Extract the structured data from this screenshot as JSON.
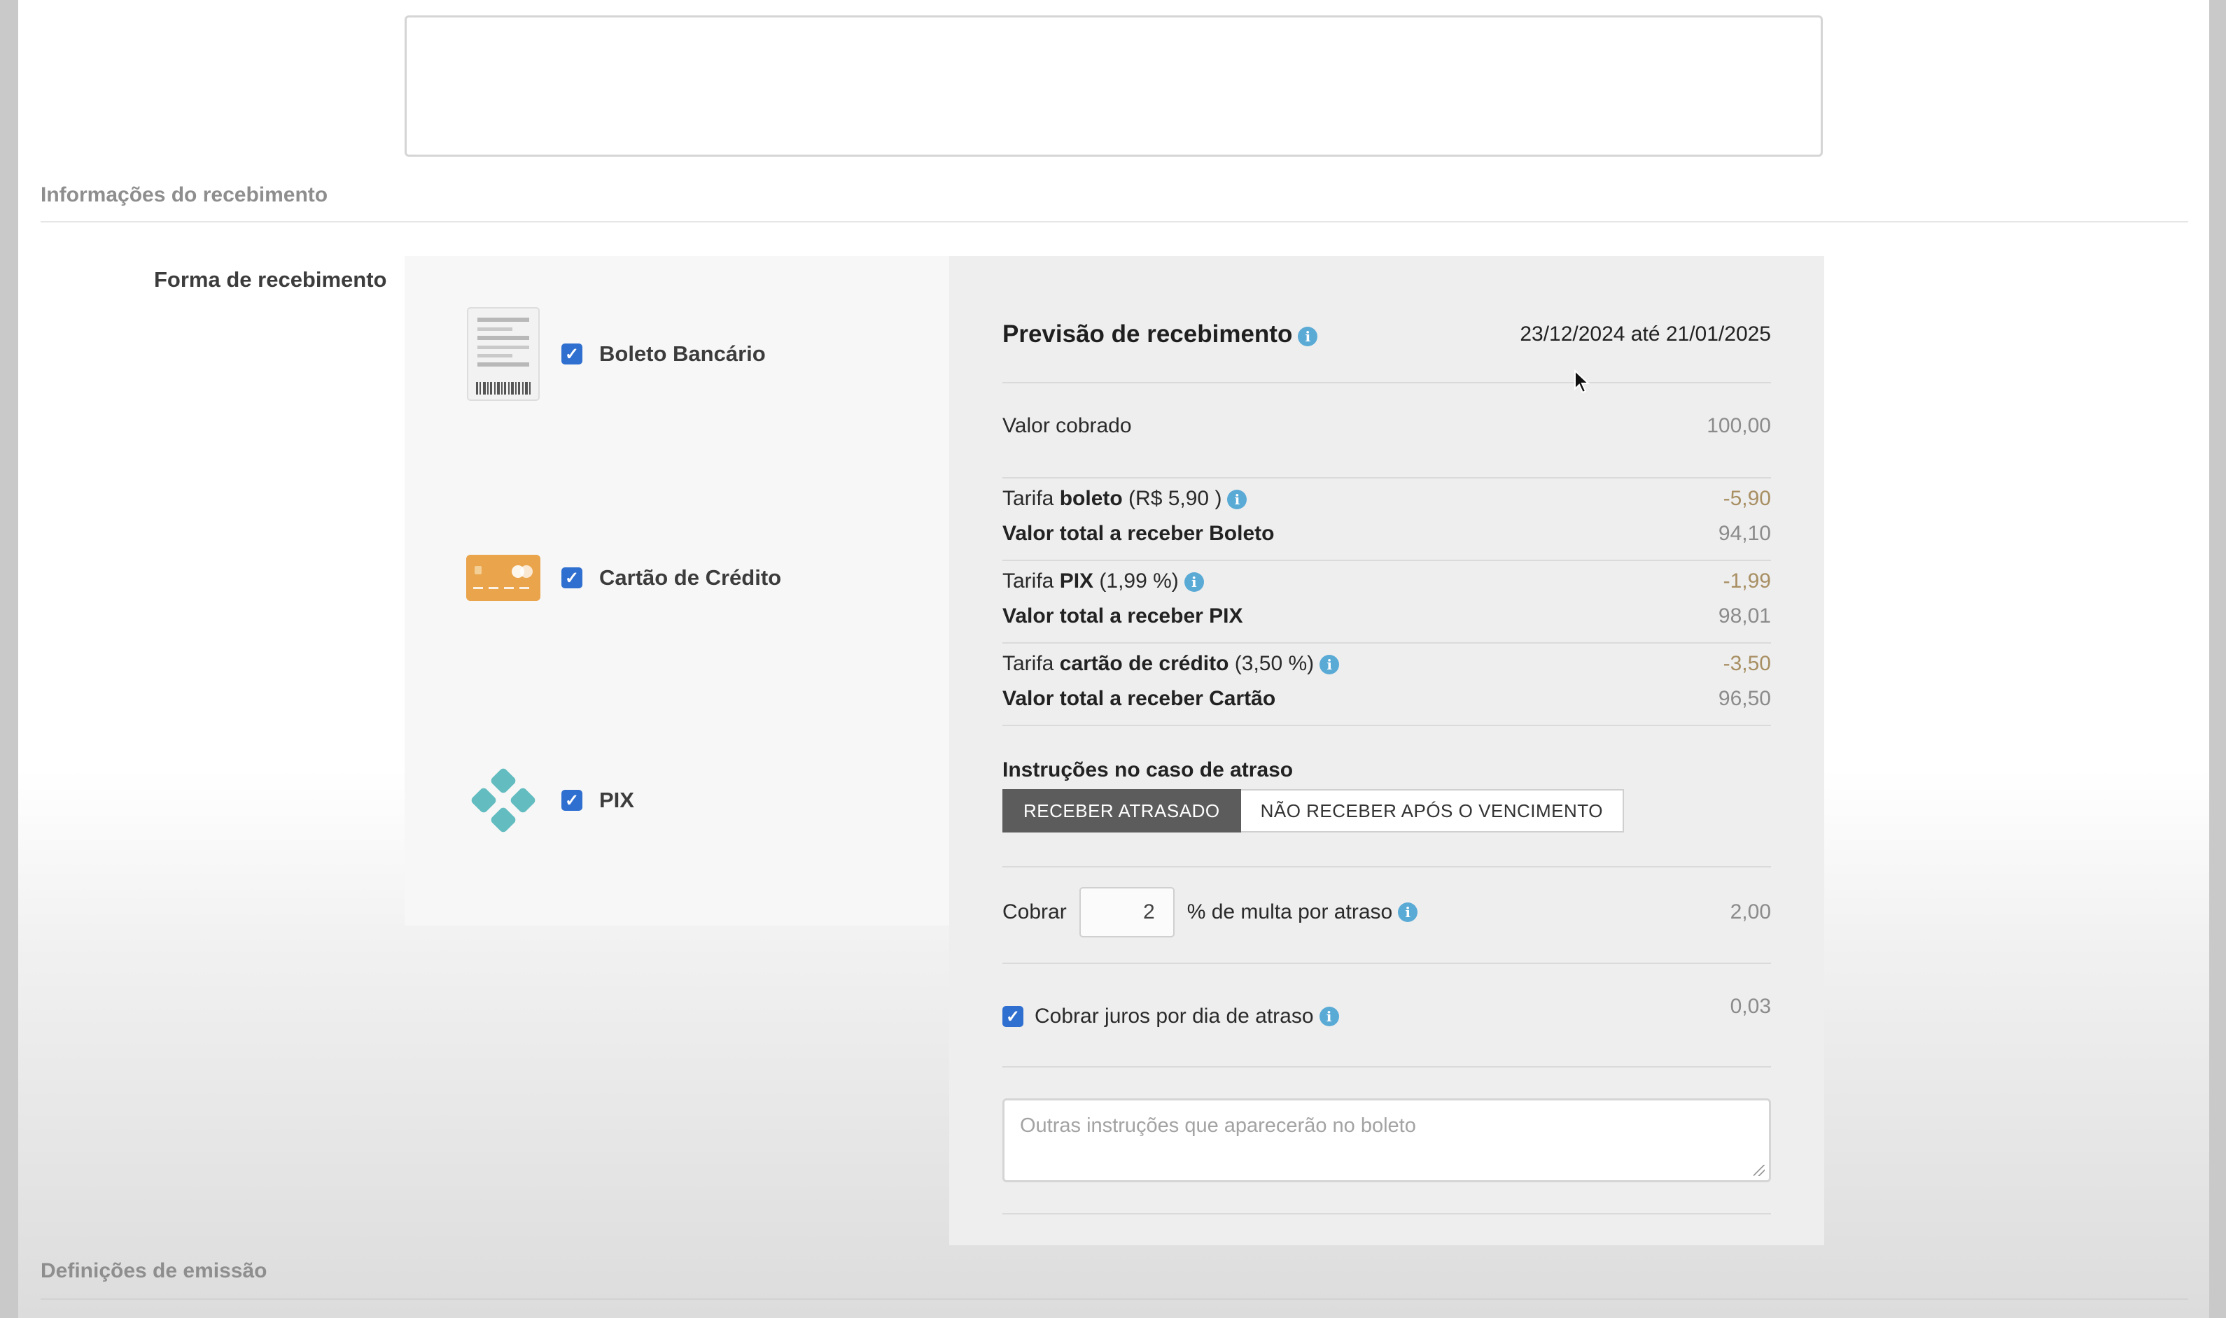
{
  "sections": {
    "receipt_info": "Informações do recebimento",
    "issue_settings": "Definições de emissão"
  },
  "payment_method_label": "Forma de recebimento",
  "methods": [
    {
      "label": "Boleto Bancário",
      "checked": true,
      "icon": "boleto-icon"
    },
    {
      "label": "Cartão de Crédito",
      "checked": true,
      "icon": "credit-card-icon"
    },
    {
      "label": "PIX",
      "checked": true,
      "icon": "pix-icon"
    }
  ],
  "summary": {
    "title": "Previsão de recebimento",
    "date_range": "23/12/2024 até 21/01/2025",
    "charged_label": "Valor cobrado",
    "charged_value": "100,00",
    "boleto_fee_pre": "Tarifa",
    "boleto_fee_bold": "boleto",
    "boleto_fee_post": "(R$ 5,90 )",
    "boleto_fee_value": "-5,90",
    "boleto_total_label": "Valor total a receber Boleto",
    "boleto_total_value": "94,10",
    "pix_fee_pre": "Tarifa",
    "pix_fee_bold": "PIX",
    "pix_fee_post": "(1,99 %)",
    "pix_fee_value": "-1,99",
    "pix_total_label": "Valor total a receber PIX",
    "pix_total_value": "98,01",
    "card_fee_pre": "Tarifa",
    "card_fee_bold": "cartão de crédito",
    "card_fee_post": "(3,50 %)",
    "card_fee_value": "-3,50",
    "card_total_label": "Valor total a receber Cartão",
    "card_total_value": "96,50"
  },
  "late": {
    "title": "Instruções no caso de atraso",
    "btn_receive_late": "RECEBER ATRASADO",
    "btn_no_receive": "NÃO RECEBER APÓS O VENCIMENTO",
    "charge_label": "Cobrar",
    "fine_percent": "2",
    "fine_label": "% de multa por atraso",
    "fine_value": "2,00",
    "interest_label": "Cobrar juros por dia de atraso",
    "interest_checked": true,
    "interest_value": "0,03",
    "other_placeholder": "Outras instruções que aparecerão no boleto"
  },
  "colors": {
    "checkbox": "#2f6fd0",
    "info_icon": "#5aaad6",
    "card_icon": "#e9a44c",
    "pix_icon": "#62bcc0",
    "active_button": "#5c5c5c"
  }
}
